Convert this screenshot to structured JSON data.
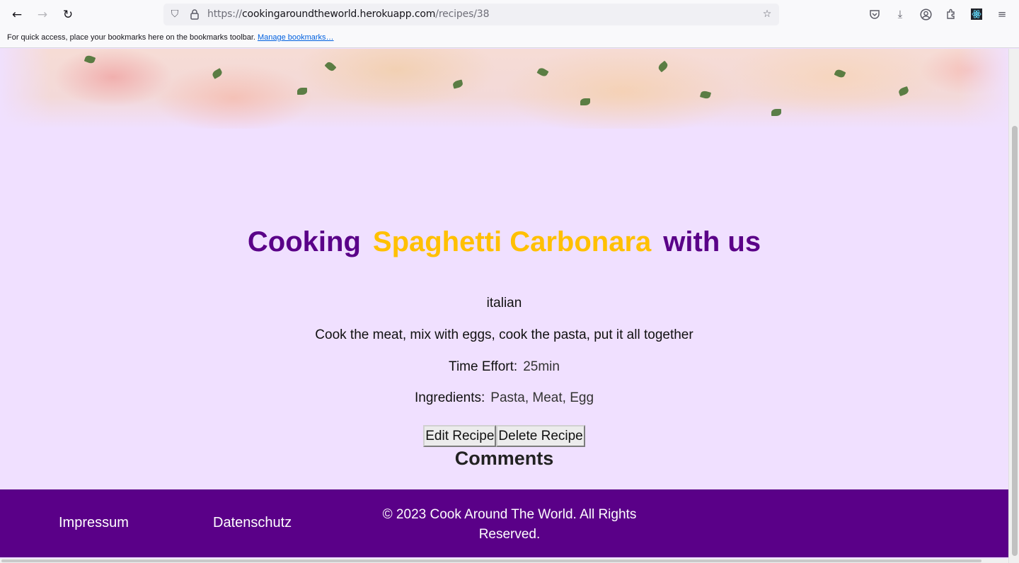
{
  "browser": {
    "url_scheme": "https://",
    "url_host": "cookingaroundtheworld.herokuapp.com",
    "url_path": "/recipes/38",
    "bookmarks_text": "For quick access, place your bookmarks here on the bookmarks toolbar.",
    "bookmarks_link": "Manage bookmarks…"
  },
  "recipe": {
    "title_prefix": "Cooking",
    "title_name": "Spaghetti Carbonara",
    "title_suffix": "with us",
    "cuisine": "italian",
    "description": "Cook the meat, mix with eggs, cook the pasta, put it all together",
    "time_label": "Time Effort:",
    "time_value": "25min",
    "ingredients_label": "Ingredients:",
    "ingredients_value": "Pasta, Meat, Egg",
    "edit_label": "Edit Recipe",
    "delete_label": "Delete Recipe",
    "comments_heading": "Comments"
  },
  "footer": {
    "impressum": "Impressum",
    "datenschutz": "Datenschutz",
    "copyright": "© 2023 Cook Around The World. All Rights Reserved."
  },
  "colors": {
    "brand_purple": "#5a0088",
    "accent_gold": "#ffc000",
    "page_background": "#f0e0ff"
  }
}
